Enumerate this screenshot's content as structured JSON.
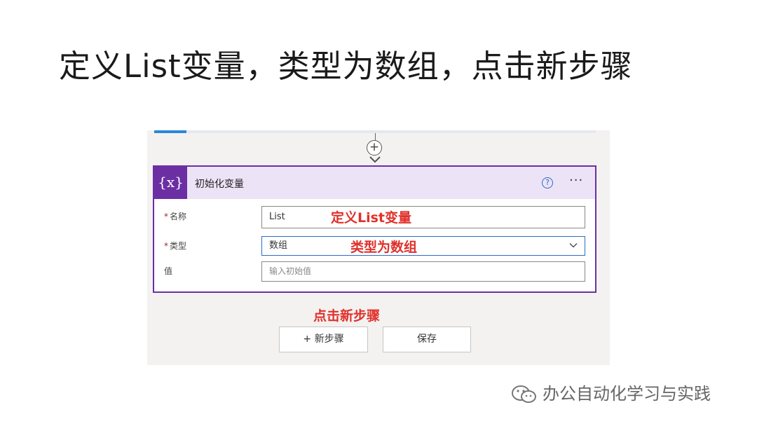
{
  "slide": {
    "title": "定义List变量，类型为数组，点击新步骤"
  },
  "flow": {
    "add_step_symbol": "+",
    "card": {
      "icon_text": "{x}",
      "title": "初始化变量",
      "help_symbol": "?",
      "more_symbol": "···",
      "accent_color": "#6b2fa3",
      "fields": {
        "name": {
          "required_mark": "*",
          "label": "名称",
          "value": "List"
        },
        "type": {
          "required_mark": "*",
          "label": "类型",
          "value": "数组"
        },
        "value": {
          "label": "值",
          "placeholder": "输入初始值"
        }
      }
    },
    "buttons": {
      "new_step": "+ 新步骤",
      "save": "保存"
    }
  },
  "annotations": {
    "name": "定义List变量",
    "type": "类型为数组",
    "new_step": "点击新步骤",
    "color": "#e0302a"
  },
  "watermark": {
    "icon": "wechat-icon",
    "text": "办公自动化学习与实践"
  }
}
